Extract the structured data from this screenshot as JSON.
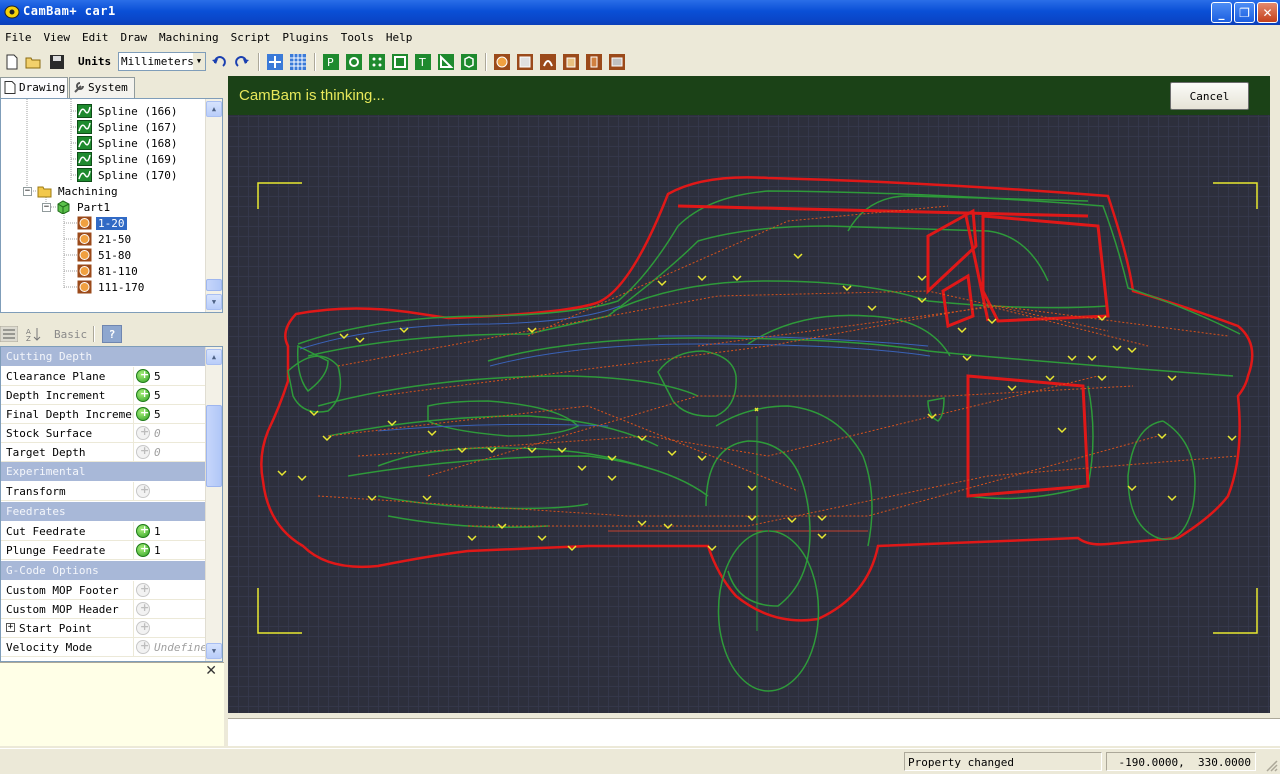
{
  "window": {
    "title": "CamBam+  car1",
    "controls": [
      "minimize",
      "maximize",
      "close"
    ]
  },
  "menu": [
    "File",
    "View",
    "Edit",
    "Draw",
    "Machining",
    "Script",
    "Plugins",
    "Tools",
    "Help"
  ],
  "toolbar": {
    "units_label": "Units",
    "units_value": "Millimeters"
  },
  "tabs": [
    {
      "label": "Drawing",
      "icon": "document-icon"
    },
    {
      "label": "System",
      "icon": "wrench-icon"
    }
  ],
  "tree": {
    "splines": [
      "Spline (166)",
      "Spline (167)",
      "Spline (168)",
      "Spline (169)",
      "Spline (170)"
    ],
    "machining_label": "Machining",
    "part_label": "Part1",
    "mops": [
      "1-20",
      "21-50",
      "51-80",
      "81-110",
      "111-170"
    ],
    "selected": "1-20"
  },
  "prop_toolbar": {
    "basic_label": "Basic",
    "help_label": "?"
  },
  "properties": {
    "categories": {
      "cutting_depth": "Cutting Depth",
      "experimental": "Experimental",
      "feedrates": "Feedrates",
      "gcode_options": "G-Code Options"
    },
    "rows": {
      "clearance_plane": {
        "name": "Clearance Plane",
        "value": "5"
      },
      "depth_increment": {
        "name": "Depth Increment",
        "value": "5"
      },
      "final_depth_increment": {
        "name": "Final Depth Increment",
        "value": "5"
      },
      "stock_surface": {
        "name": "Stock Surface",
        "value": "0"
      },
      "target_depth": {
        "name": "Target Depth",
        "value": "0"
      },
      "transform": {
        "name": "Transform",
        "value": ""
      },
      "cut_feedrate": {
        "name": "Cut Feedrate",
        "value": "1"
      },
      "plunge_feedrate": {
        "name": "Plunge Feedrate",
        "value": "1"
      },
      "custom_mop_footer": {
        "name": "Custom MOP Footer",
        "value": ""
      },
      "custom_mop_header": {
        "name": "Custom MOP Header",
        "value": ""
      },
      "start_point": {
        "name": "Start Point",
        "value": ""
      },
      "velocity_mode": {
        "name": "Velocity Mode",
        "value": "Undefined"
      }
    }
  },
  "canvas": {
    "thinking_message": "CamBam is thinking...",
    "cancel_label": "Cancel",
    "colors": {
      "background": "#2d2f3c",
      "outline": "#e01818",
      "toolpath": "#2e9a3a",
      "rapid": "#d8521c",
      "marker": "#e8e830"
    }
  },
  "status": {
    "message": "Property changed",
    "coords": "-190.0000,  330.0000"
  }
}
